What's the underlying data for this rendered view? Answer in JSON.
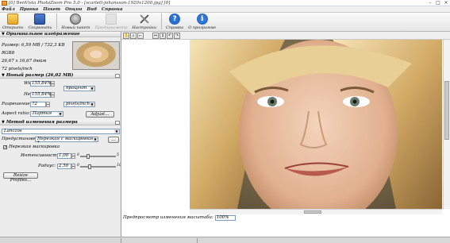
{
  "window": {
    "title": "[0] BenVista PhotoZoom Pro 5.0 - [scarlett-johansson-1920x1200.jpg] [0]"
  },
  "menu": [
    "Файл",
    "Правка",
    "Пакет",
    "Опции",
    "Вид",
    "Справка"
  ],
  "toolbar": [
    {
      "label": "Открыть",
      "icon": "open-folder-icon",
      "enabled": true
    },
    {
      "label": "Сохранить",
      "icon": "save-disk-icon",
      "enabled": true
    },
    {
      "label": "Новый пакет",
      "icon": "batch-disc-icon",
      "enabled": true
    },
    {
      "label": "Предпросмотр",
      "icon": "preview-icon",
      "enabled": false
    },
    {
      "label": "Настройки",
      "icon": "settings-tools-icon",
      "enabled": true
    },
    {
      "label": "Справка",
      "icon": "help-icon",
      "enabled": true
    },
    {
      "label": "О программе",
      "icon": "info-icon",
      "enabled": true
    }
  ],
  "original": {
    "header": "Оригинальное изображение",
    "size": "Размер: 6,59 MB / 732,3 KB",
    "mode": "RGB8",
    "dims": "26,67 x 16,67 дюйм",
    "res": "72 pixels/inch"
  },
  "newsize": {
    "header": "Новый размер (26,02 MB)",
    "width_label": "Width:",
    "width_value": "155,84%",
    "height_label": "Height:",
    "height_value": "155,84%",
    "unit": "процент",
    "res_label": "Разрешение",
    "res_value": "72",
    "res_unit": "pixels/inch",
    "aspect_label": "Aspect ratio:",
    "aspect_value": "Партия",
    "adjust_btn": "Adjust..."
  },
  "method": {
    "header": "Метод изменения размера",
    "method_value": "Lanczos",
    "preset_label": "Предустановки:",
    "preset_value": "Нерезкая с маскировкой *",
    "unsharp_label": "Нерезкая маскировка",
    "unsharp_checked": true,
    "intensity_label": "Интенсивность:",
    "intensity_value": "1,00",
    "intensity_min": "0",
    "intensity_max": "5",
    "intensity_fraction": 0.2,
    "radius_label": "Радиус:",
    "radius_value": "2,50",
    "radius_min": "0",
    "radius_max": "10",
    "radius_fraction": 0.25,
    "resize_btn": "Resize Profiles..."
  },
  "preview": {
    "zoom_label": "Предпросмотр изменения масштаба:",
    "zoom_value": "100%"
  },
  "colors": {
    "accent": "#2b56a4",
    "panel": "#ececec"
  }
}
